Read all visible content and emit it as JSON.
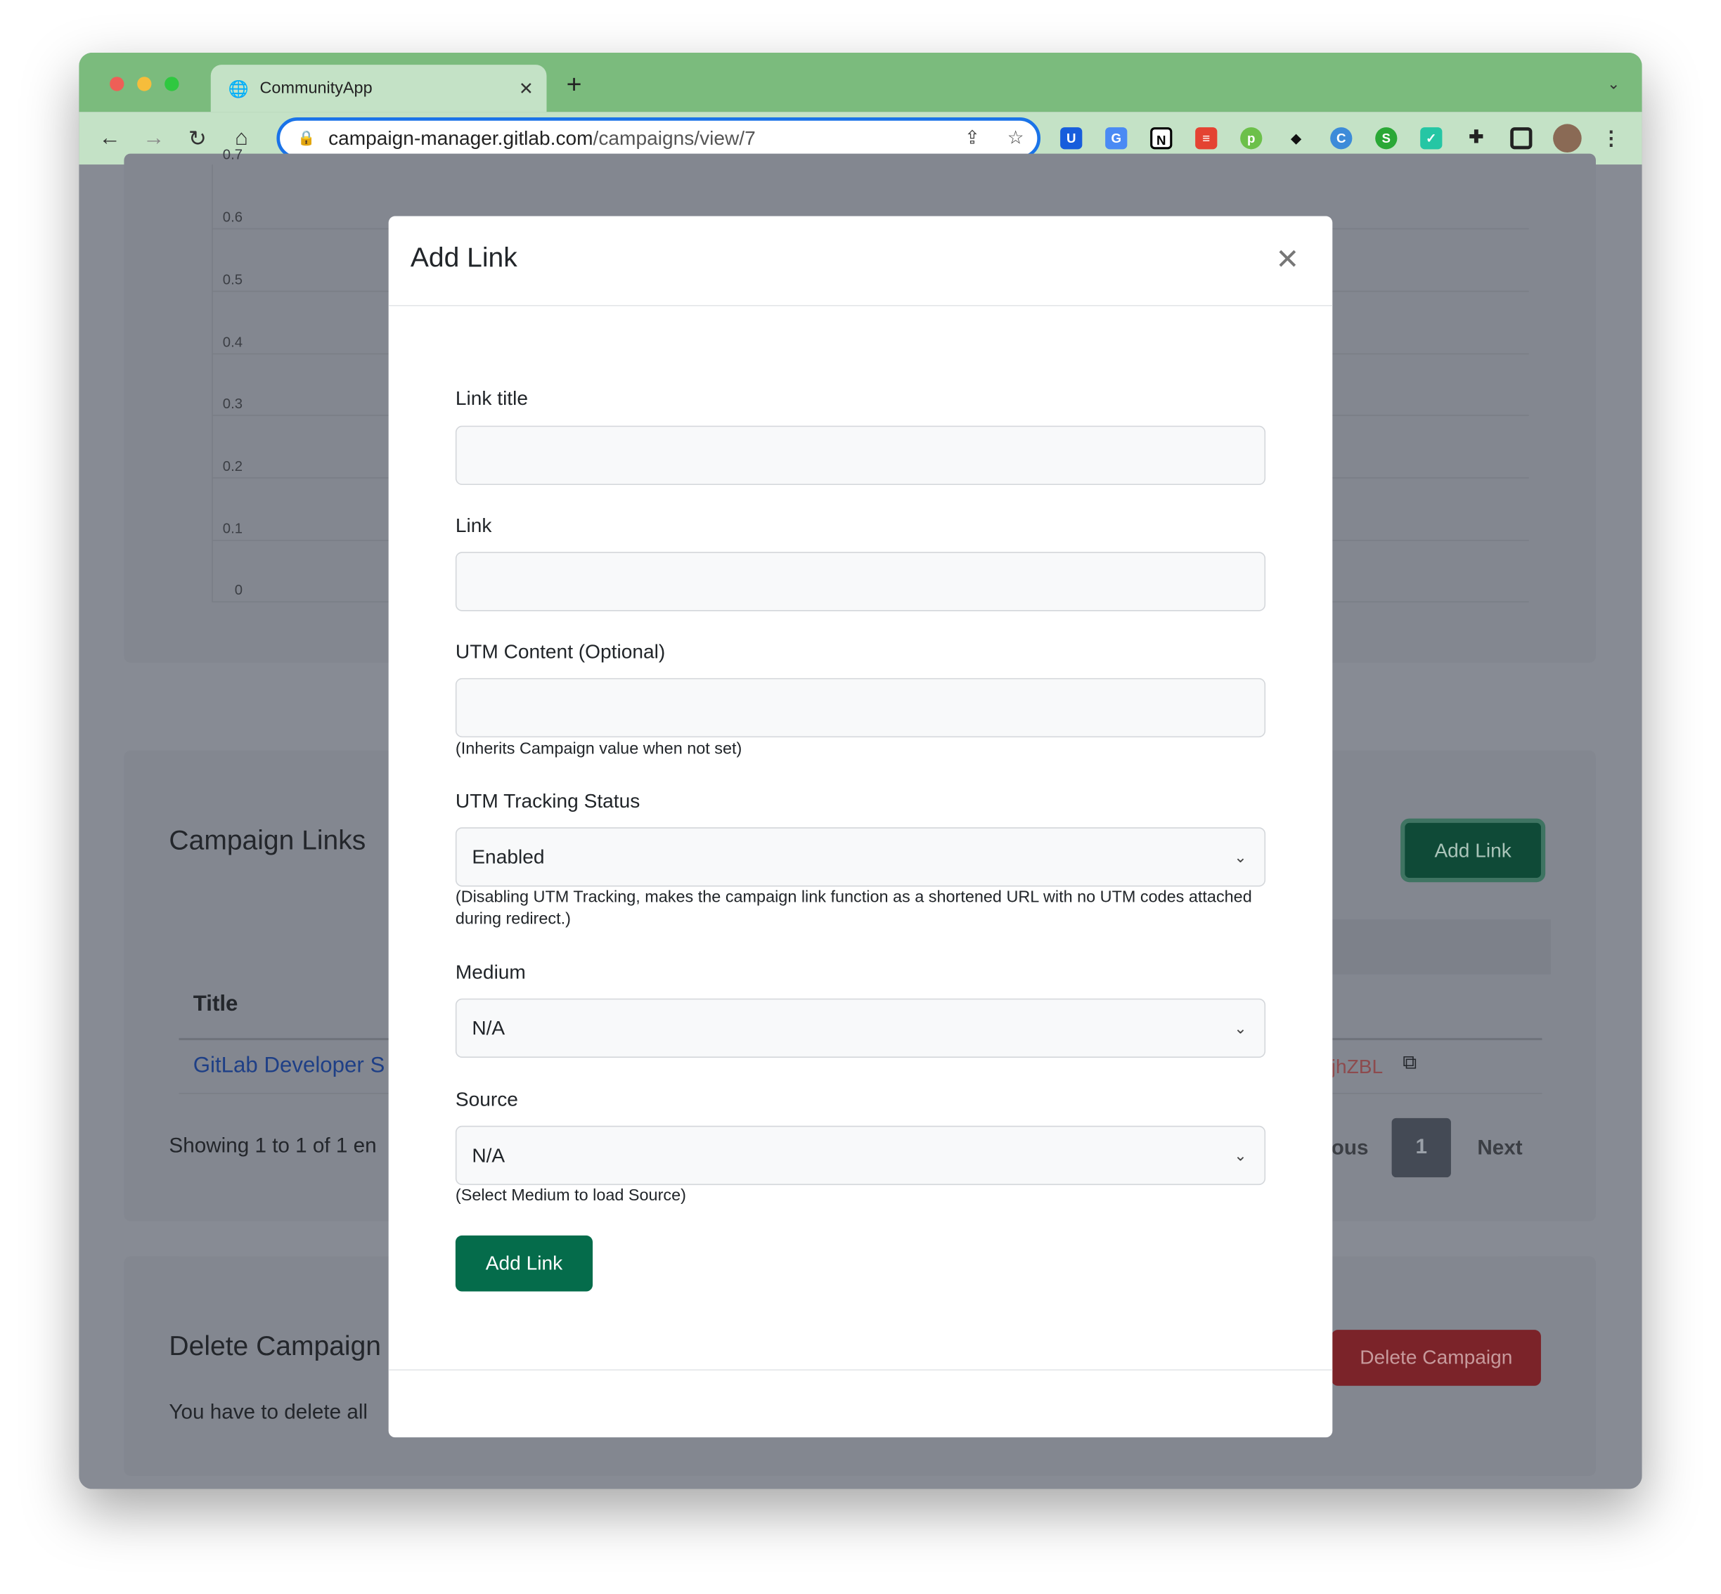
{
  "browser": {
    "tab_title": "CommunityApp",
    "url_host": "campaign-manager.gitlab.com",
    "url_path": "/campaigns/view/7"
  },
  "background": {
    "chart_y_ticks": [
      "0.7",
      "0.6",
      "0.5",
      "0.4",
      "0.3",
      "0.2",
      "0.1",
      "0"
    ],
    "links_title": "Campaign Links",
    "add_link": "Add Link",
    "col_title": "Title",
    "row_title": "GitLab Developer S",
    "row_short": "jhZBL",
    "showing": "Showing 1 to 1 of 1 en",
    "prev": "ous",
    "page": "1",
    "next": "Next",
    "delete_title": "Delete Campaign",
    "delete_text": "You have to delete all",
    "delete_button": "Delete Campaign"
  },
  "modal": {
    "title": "Add Link",
    "fields": {
      "link_title": {
        "label": "Link title",
        "value": ""
      },
      "link": {
        "label": "Link",
        "value": ""
      },
      "utm_content": {
        "label": "UTM Content (Optional)",
        "value": "",
        "help": "(Inherits Campaign value when not set)"
      },
      "utm_status": {
        "label": "UTM Tracking Status",
        "value": "Enabled",
        "help": "(Disabling UTM Tracking, makes the campaign link function as a shortened URL with no UTM codes attached during redirect.)"
      },
      "medium": {
        "label": "Medium",
        "value": "N/A"
      },
      "source": {
        "label": "Source",
        "value": "N/A",
        "help": "(Select Medium to load Source)"
      }
    },
    "submit": "Add Link"
  },
  "colors": {
    "primary": "#056c4b",
    "danger": "#8b2128",
    "chrome": "#7bbb7d"
  }
}
